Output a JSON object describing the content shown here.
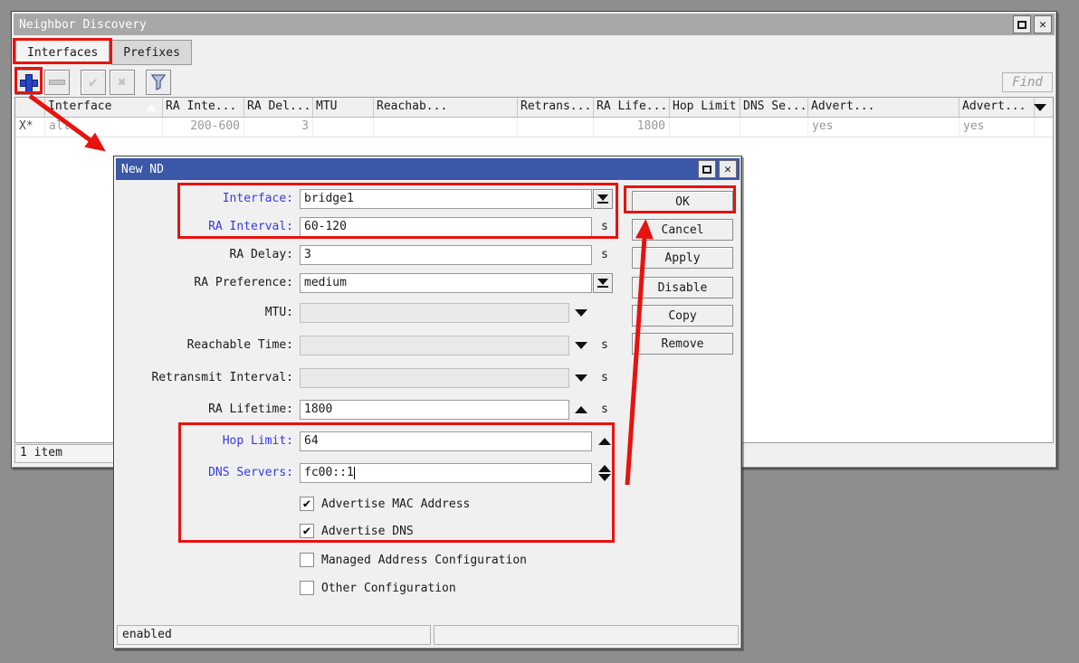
{
  "icons": {
    "check": "✔",
    "close": "✕",
    "x_mark": "✖",
    "check_tool": "✔"
  },
  "main_window": {
    "title": "Neighbor Discovery",
    "tabs": [
      {
        "label": "Interfaces"
      },
      {
        "label": "Prefixes"
      }
    ],
    "toolbar": {
      "find_label": "Find"
    },
    "table": {
      "headers": [
        "Interface",
        "RA Inte...",
        "RA Del...",
        "MTU",
        "Reachab...",
        "Retrans...",
        "RA Life...",
        "Hop Limit",
        "DNS Se...",
        "Advert...",
        "Advert..."
      ],
      "row": {
        "flags": "X*",
        "cells": [
          "all",
          "200-600",
          "3",
          "",
          "",
          "",
          "1800",
          "",
          "",
          "yes",
          "yes"
        ]
      },
      "status": "1 item"
    }
  },
  "dialog": {
    "title": "New ND",
    "fields": [
      {
        "label": "Interface:",
        "value": "bridge1"
      },
      {
        "label": "RA Interval:",
        "value": "60-120",
        "suffix": "s"
      },
      {
        "label": "RA Delay:",
        "value": "3",
        "suffix": "s"
      },
      {
        "label": "RA Preference:",
        "value": "medium"
      },
      {
        "label": "MTU:",
        "value": ""
      },
      {
        "label": "Reachable Time:",
        "value": "",
        "suffix": "s"
      },
      {
        "label": "Retransmit Interval:",
        "value": "",
        "suffix": "s"
      },
      {
        "label": "RA Lifetime:",
        "value": "1800",
        "suffix": "s"
      },
      {
        "label": "Hop Limit:",
        "value": "64"
      },
      {
        "label": "DNS Servers:",
        "value": "fc00::1"
      }
    ],
    "checkboxes": [
      {
        "label": "Advertise MAC Address",
        "checked": true
      },
      {
        "label": "Advertise DNS",
        "checked": true
      },
      {
        "label": "Managed Address Configuration",
        "checked": false
      },
      {
        "label": "Other Configuration",
        "checked": false
      }
    ],
    "buttons": [
      "OK",
      "Cancel",
      "Apply",
      "Disable",
      "Copy",
      "Remove"
    ],
    "status_left": "enabled"
  },
  "annotation_color": "#e8120e"
}
